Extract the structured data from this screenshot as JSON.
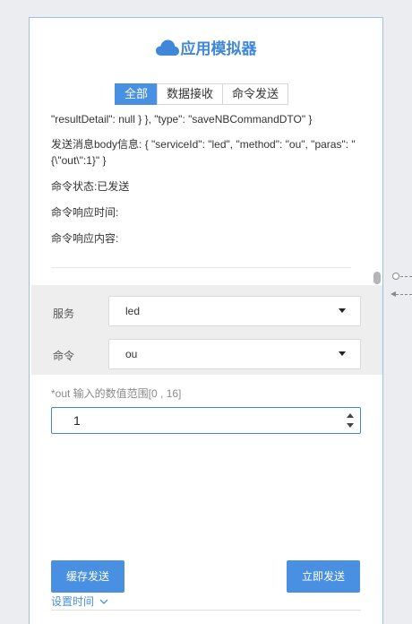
{
  "app": {
    "title": "应用模拟器"
  },
  "tabs": [
    {
      "label": "全部",
      "active": true
    },
    {
      "label": "数据接收",
      "active": false
    },
    {
      "label": "命令发送",
      "active": false
    }
  ],
  "log": {
    "result_line": "\"resultDetail\": null } }, \"type\": \"saveNBCommandDTO\" }",
    "send_body": "发送消息body信息: { \"serviceId\": \"led\", \"method\": \"ou\", \"paras\": \"{\\\"out\\\":1}\" }",
    "cmd_status": "命令状态:已发送",
    "cmd_response_time": "命令响应时间:",
    "cmd_response_content": "命令响应内容:"
  },
  "form": {
    "service_label": "服务",
    "service_value": "led",
    "command_label": "命令",
    "command_value": "ou",
    "hint": "*out 输入的数值范围[0 , 16]",
    "number_value": "1"
  },
  "buttons": {
    "cache_send": "缓存发送",
    "send_now": "立即发送"
  },
  "set_time": "设置时间",
  "colors": {
    "accent": "#4a90e2",
    "panel_border": "#9cc0ee",
    "background": "#ebedf1"
  },
  "icons": {
    "logo": "cloud-icon",
    "dropdown": "caret-down-icon",
    "expand": "chevron-down-icon"
  }
}
